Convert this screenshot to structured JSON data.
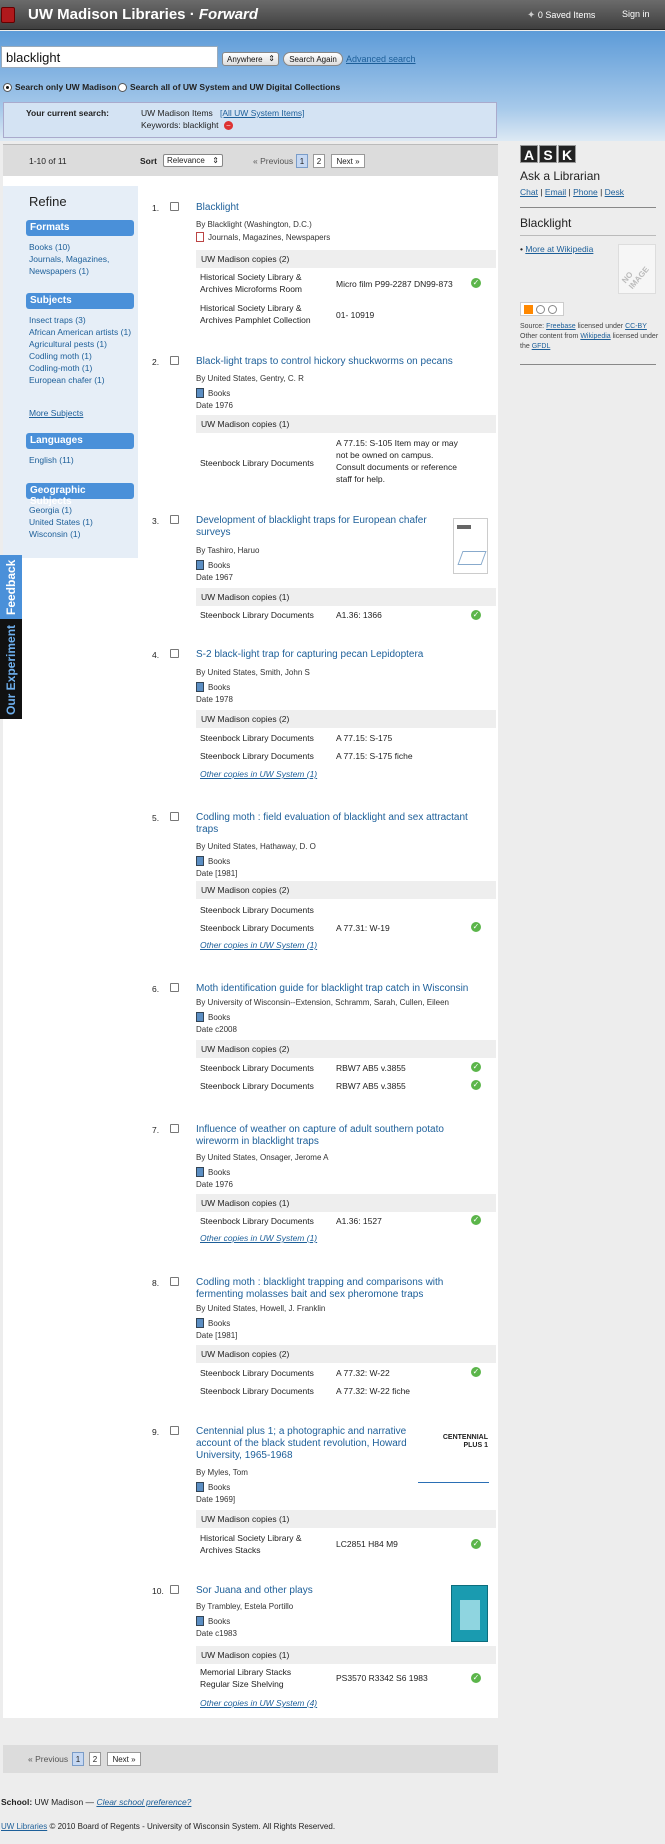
{
  "header": {
    "brand": "UW Madison Libraries",
    "brand_sep": "·",
    "brand_em": "Forward",
    "saved_items": "0 Saved Items",
    "sign_in": "Sign in"
  },
  "search": {
    "query": "blacklight",
    "scope_select": "Anywhere",
    "search_again": "Search Again",
    "advanced": "Advanced search",
    "radio_uw": "Search only UW Madison",
    "radio_all": "Search all of UW System and UW Digital Collections"
  },
  "current_search": {
    "label": "Your current search:",
    "scope": "UW Madison Items",
    "all_link": "[All UW System Items]",
    "keywords": "Keywords: blacklight"
  },
  "results_bar": {
    "range": "1-10 of 11",
    "sort_label": "Sort",
    "sort_value": "Relevance",
    "prev": "« Previous",
    "page1": "1",
    "page2": "2",
    "next": "Next »"
  },
  "refine": {
    "title": "Refine",
    "formats_h": "Formats",
    "formats": [
      "Books (10)",
      "Journals, Magazines,",
      "Newspapers (1)"
    ],
    "subjects_h": "Subjects",
    "subjects": [
      "Insect traps (3)",
      "African American artists (1)",
      "Agricultural pests (1)",
      "Codling moth (1)",
      "Codling-moth (1)",
      "European chafer (1)"
    ],
    "more_subjects": "More Subjects",
    "languages_h": "Languages",
    "languages": [
      "English (11)"
    ],
    "geo_h": "Geographic Subjects",
    "geo": [
      "Georgia (1)",
      "United States (1)",
      "Wisconsin (1)"
    ]
  },
  "side_tabs": {
    "feedback": "Feedback",
    "experiment": "Our Experiment"
  },
  "results": [
    {
      "num": "1.",
      "title": "Blacklight",
      "by": "By Blacklight (Washington, D.C.)",
      "format": "Journals, Magazines, Newspapers",
      "date": "",
      "copies_h": "UW Madison copies (2)",
      "copies": [
        [
          "Historical Society Library & Archives Microforms Room",
          "Micro film P99-2287 DN99-873"
        ],
        [
          "Historical Society Library & Archives Pamphlet Collection",
          "01- 10919"
        ]
      ],
      "other": ""
    },
    {
      "num": "2.",
      "title": "Black-light traps to control hickory shuckworms on pecans",
      "by": "By United States, Gentry, C. R",
      "format": "Books",
      "date": "Date 1976",
      "copies_h": "UW Madison copies (1)",
      "copies": [
        [
          "Steenbock Library Documents",
          "A 77.15: S-105 Item may or may not be owned on campus. Consult documents or reference staff for help."
        ]
      ],
      "other": ""
    },
    {
      "num": "3.",
      "title": "Development of blacklight traps for European chafer surveys",
      "by": "By Tashiro, Haruo",
      "format": "Books",
      "date": "Date 1967",
      "copies_h": "UW Madison copies (1)",
      "copies": [
        [
          "Steenbock Library Documents",
          "A1.36: 1366"
        ]
      ],
      "other": ""
    },
    {
      "num": "4.",
      "title": "S-2 black-light trap for capturing pecan Lepidoptera",
      "by": "By United States, Smith, John S",
      "format": "Books",
      "date": "Date 1978",
      "copies_h": "UW Madison copies (2)",
      "copies": [
        [
          "Steenbock Library Documents",
          "A 77.15: S-175"
        ],
        [
          "Steenbock Library Documents",
          "A 77.15: S-175 fiche"
        ]
      ],
      "other": "Other copies in UW System (1)"
    },
    {
      "num": "5.",
      "title": "Codling moth : field evaluation of blacklight and sex attractant traps",
      "by": "By United States, Hathaway, D. O",
      "format": "Books",
      "date": "Date [1981]",
      "copies_h": "UW Madison copies (2)",
      "copies": [
        [
          "Steenbock Library Documents",
          ""
        ],
        [
          "Steenbock Library Documents",
          "A 77.31: W-19"
        ]
      ],
      "other": "Other copies in UW System (1)"
    },
    {
      "num": "6.",
      "title": "Moth identification guide for blacklight trap catch in Wisconsin",
      "by": "By University of Wisconsin--Extension, Schramm, Sarah, Cullen, Eileen",
      "format": "Books",
      "date": "Date c2008",
      "copies_h": "UW Madison copies (2)",
      "copies": [
        [
          "Steenbock Library Documents",
          "RBW7 AB5 v.3855"
        ],
        [
          "Steenbock Library Documents",
          "RBW7 AB5 v.3855"
        ]
      ],
      "other": ""
    },
    {
      "num": "7.",
      "title": "Influence of weather on capture of adult southern potato wireworm in blacklight traps",
      "by": "By United States, Onsager, Jerome A",
      "format": "Books",
      "date": "Date 1976",
      "copies_h": "UW Madison copies (1)",
      "copies": [
        [
          "Steenbock Library Documents",
          "A1.36: 1527"
        ]
      ],
      "other": "Other copies in UW System (1)"
    },
    {
      "num": "8.",
      "title": "Codling moth : blacklight trapping and comparisons with fermenting molasses bait and sex pheromone traps",
      "by": "By United States, Howell, J. Franklin",
      "format": "Books",
      "date": "Date [1981]",
      "copies_h": "UW Madison copies (2)",
      "copies": [
        [
          "Steenbock Library Documents",
          "A 77.32: W-22"
        ],
        [
          "Steenbock Library Documents",
          "A 77.32: W-22 fiche"
        ]
      ],
      "other": ""
    },
    {
      "num": "9.",
      "title": "Centennial plus 1; a photographic and narrative account of the black student revolution, Howard University, 1965-1968",
      "by": "By Myles, Tom",
      "format": "Books",
      "date": "Date 1969]",
      "copies_h": "UW Madison copies (1)",
      "copies": [
        [
          "Historical Society Library & Archives Stacks",
          "LC2851 H84 M9"
        ]
      ],
      "other": ""
    },
    {
      "num": "10.",
      "title": "Sor Juana and other plays",
      "by": "By Trambley, Estela Portillo",
      "format": "Books",
      "date": "Date c1983",
      "copies_h": "UW Madison copies (1)",
      "copies": [
        [
          "Memorial Library Stacks Regular Size Shelving",
          "PS3570 R3342 S6 1983"
        ]
      ],
      "other": "Other copies in UW System (4)"
    }
  ],
  "thumb_text": {
    "centennial": "CENTENNIAL PLUS 1"
  },
  "right": {
    "ask": [
      "A",
      "S",
      "K"
    ],
    "ask_title": "Ask a Librarian",
    "ask_links": [
      "Chat",
      "Email",
      "Phone",
      "Desk"
    ],
    "term": "Blacklight",
    "wiki_link": "More at Wikipedia",
    "no_image": "NO IMAGE",
    "source_prefix": "Source:",
    "freebase": "Freebase",
    "licensed": "licensed under",
    "ccby": "CC-BY",
    "other_content": "Other content from",
    "wikipedia": "Wikipedia",
    "licensed2": "licensed under the",
    "gfdl": "GFDL"
  },
  "footer": {
    "school_label": "School:",
    "school_value": "UW Madison —",
    "clear": "Clear school preference?",
    "uwl": "UW Libraries",
    "copyright": "© 2010 Board of Regents - University of Wisconsin System. All Rights Reserved."
  },
  "colors": {
    "accent": "#4a90d9",
    "link": "#1d5f99",
    "available": "#5bb54a",
    "brand_red": "#b0191c"
  }
}
